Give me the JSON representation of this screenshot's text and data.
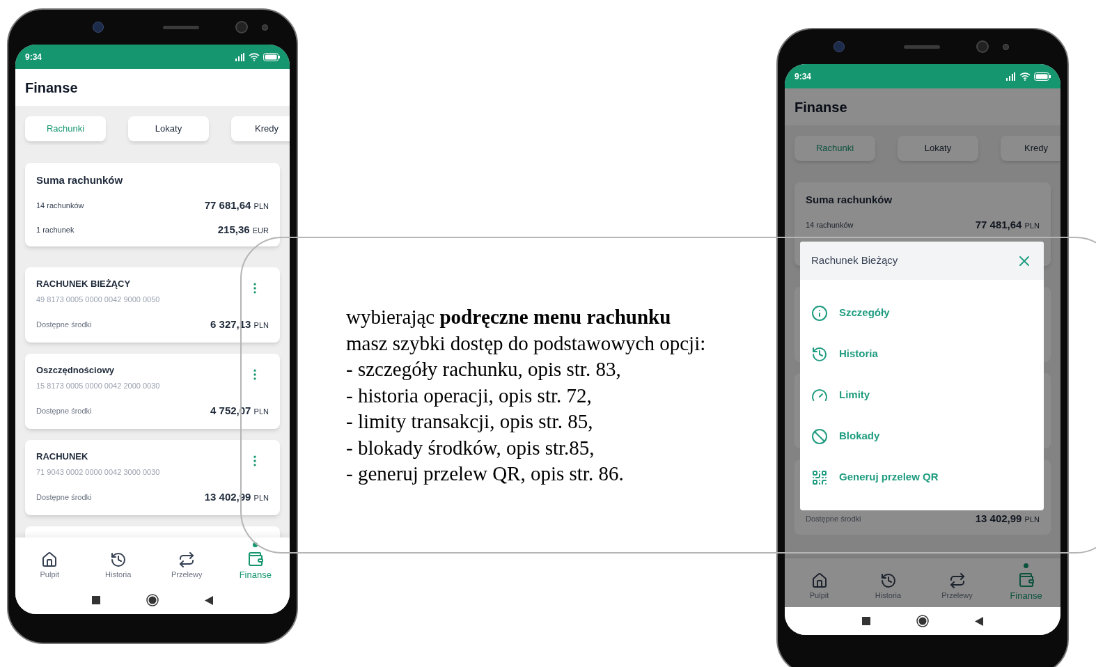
{
  "left_phone": {
    "status_time": "9:34",
    "title": "Finanse",
    "tabs": [
      {
        "label": "Rachunki",
        "selected": true
      },
      {
        "label": "Lokaty",
        "selected": false
      },
      {
        "label": "Kredy",
        "selected": false
      }
    ],
    "summary": {
      "title": "Suma rachunków",
      "rows": [
        {
          "label": "14 rachunków",
          "amount": "77 681,64",
          "currency": "PLN"
        },
        {
          "label": "1 rachunek",
          "amount": "215,36",
          "currency": "EUR"
        }
      ]
    },
    "accounts": [
      {
        "name": "RACHUNEK BIEŻĄCY",
        "number": "49 8173 0005 0000 0042 9000 0050",
        "available_label": "Dostępne środki",
        "amount": "6 327,13",
        "currency": "PLN"
      },
      {
        "name": "Oszczędnościowy",
        "number": "15 8173 0005 0000 0042 2000 0030",
        "available_label": "Dostępne środki",
        "amount": "4 752,07",
        "currency": "PLN"
      },
      {
        "name": "RACHUNEK",
        "number": "71 9043 0002 0000 0042 3000 0030",
        "available_label": "Dostępne środki",
        "amount": "13 402,99",
        "currency": "PLN"
      }
    ],
    "nav": [
      {
        "label": "Pulpit",
        "kind": "home",
        "selected": false
      },
      {
        "label": "Historia",
        "kind": "history",
        "selected": false
      },
      {
        "label": "Przelewy",
        "kind": "transfer",
        "selected": false
      },
      {
        "label": "Finanse",
        "kind": "wallet",
        "selected": true
      }
    ]
  },
  "description": {
    "lines": [
      "wybierając **podręczne menu rachunku**",
      "masz szybki dostęp do podstawowych opcji:",
      "- szczegóły rachunku, opis str. 83,",
      "- historia operacji, opis str. 72,",
      "- limity transakcji, opis str. 85,",
      "- blokady środków, opis str.85,",
      "- generuj przelew QR, opis str. 86."
    ]
  },
  "right_phone": {
    "status_time": "9:34",
    "title": "Finanse",
    "tabs": [
      {
        "label": "Rachunki",
        "selected": true
      },
      {
        "label": "Lokaty",
        "selected": false
      },
      {
        "label": "Kredy",
        "selected": false
      }
    ],
    "summary": {
      "title": "Suma rachunków",
      "rows": [
        {
          "label": "14 rachunków",
          "amount": "77 481,64",
          "currency": "PLN"
        }
      ]
    },
    "last_account": {
      "available_label": "Dostępne środki",
      "amount": "13 402,99",
      "currency": "PLN"
    },
    "modal": {
      "title": "Rachunek Bieżący",
      "items": [
        {
          "label": "Szczegóły",
          "kind": "info"
        },
        {
          "label": "Historia",
          "kind": "history"
        },
        {
          "label": "Limity",
          "kind": "gauge"
        },
        {
          "label": "Blokady",
          "kind": "block"
        },
        {
          "label": "Generuj przelew QR",
          "kind": "qr"
        }
      ]
    },
    "nav": [
      {
        "label": "Pulpit",
        "kind": "home",
        "selected": false
      },
      {
        "label": "Historia",
        "kind": "history",
        "selected": false
      },
      {
        "label": "Przelewy",
        "kind": "transfer",
        "selected": false
      },
      {
        "label": "Finanse",
        "kind": "wallet",
        "selected": true
      }
    ]
  }
}
